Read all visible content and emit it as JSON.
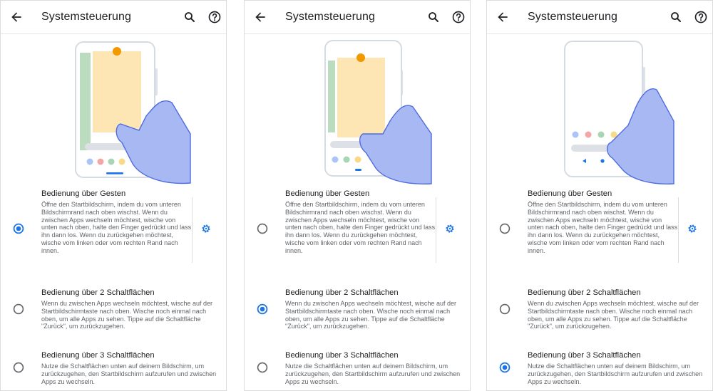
{
  "panels": [
    {
      "title": "Systemsteuerung",
      "selected": 0,
      "illustration": "gesture"
    },
    {
      "title": "Systemsteuerung",
      "selected": 1,
      "illustration": "two-button"
    },
    {
      "title": "Systemsteuerung",
      "selected": 2,
      "illustration": "three-button"
    }
  ],
  "options": [
    {
      "title": "Bedienung über Gesten",
      "description": "Öffne den Startbildschirm, indem du vom unteren Bildschirmrand nach oben wischst. Wenn du zwischen Apps wechseln möchtest, wische von unten nach oben, halte den Finger gedrückt und lass ihn dann los. Wenn du zurückgehen möchtest, wische vom linken oder vom rechten Rand nach innen.",
      "settings_icon": "gear-icon"
    },
    {
      "title": "Bedienung über 2 Schaltflächen",
      "description": "Wenn du zwischen Apps wechseln möchtest, wische auf der Startbildschirmtaste nach oben. Wische noch einmal nach oben, um alle Apps zu sehen. Tippe auf die Schaltfläche \"Zurück\", um zurückzugehen."
    },
    {
      "title": "Bedienung über 3 Schaltflächen",
      "description": "Nutze die Schaltflächen unten auf deinem Bildschirm, um zurückzugehen, den Startbildschirm aufzurufen und zwischen Apps zu wechseln."
    }
  ],
  "icons": {
    "back": "arrow-back-icon",
    "search": "search-icon",
    "help": "help-icon",
    "radio_on": "radio-selected-icon",
    "radio_off": "radio-unselected-icon"
  },
  "colors": {
    "accent": "#1a73e8",
    "hand": "#a7b8f2",
    "hand_outline": "#4f6ce0",
    "card": "#fde5b4",
    "side_card": "#bcdcc0",
    "dot": "#f29900",
    "text": "#202124",
    "secondary_text": "#5f6368"
  }
}
